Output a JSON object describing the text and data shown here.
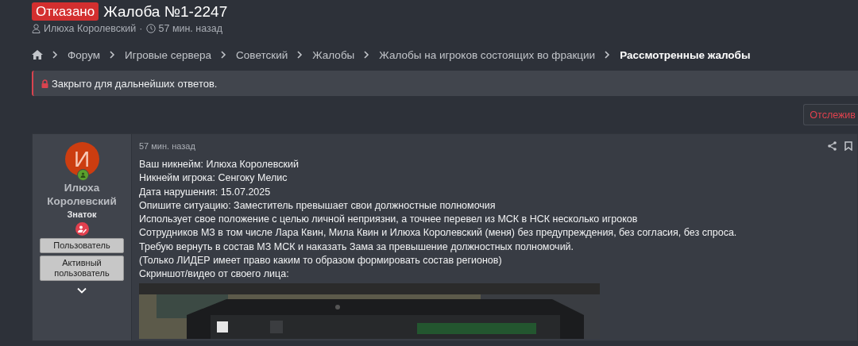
{
  "thread": {
    "status_badge": "Отказано",
    "title": "Жалоба №1-2247",
    "author": "Илюха Королевский",
    "separator": "·",
    "time": "57 мин. назад"
  },
  "breadcrumbs": [
    {
      "label": "Форум",
      "current": false
    },
    {
      "label": "Игровые сервера",
      "current": false
    },
    {
      "label": "Советский",
      "current": false
    },
    {
      "label": "Жалобы",
      "current": false
    },
    {
      "label": "Жалобы на игроков состоящих во фракции",
      "current": false
    },
    {
      "label": "Рассмотренные жалобы",
      "current": true
    }
  ],
  "notice": "Закрыто для дальнейших ответов.",
  "watch_button": "Отслежив",
  "post": {
    "user": {
      "avatar_letter": "И",
      "name": "Илюха Королевский",
      "title": "Знаток",
      "online": true,
      "banners": [
        "Пользователь",
        "Активный пользователь"
      ]
    },
    "time": "57 мин. назад",
    "lines": [
      "Ваш никнейм: Илюха Королевский",
      "Никнейм игрока: Сенгоку Мелис",
      "Дата нарушения: 15.07.2025",
      "Опишите ситуацию: Заместитель превышает свои должностные полномочия",
      "Использует свое положение с целью личной неприязни, а точнее перевел из МСК в НСК несколько игроков",
      "Сотрудников МЗ в том числе Лара Квин, Мила Квин и Илюха Королевский (меня) без предупреждения, без согласия, без спроса.",
      "Требую вернуть в состав МЗ МСК и наказать Зама за превышение должностных полномочий.",
      "(Только ЛИДЕР имеет право каким то образом формировать состав регионов)",
      "Скриншот/видео от своего лица:"
    ]
  }
}
